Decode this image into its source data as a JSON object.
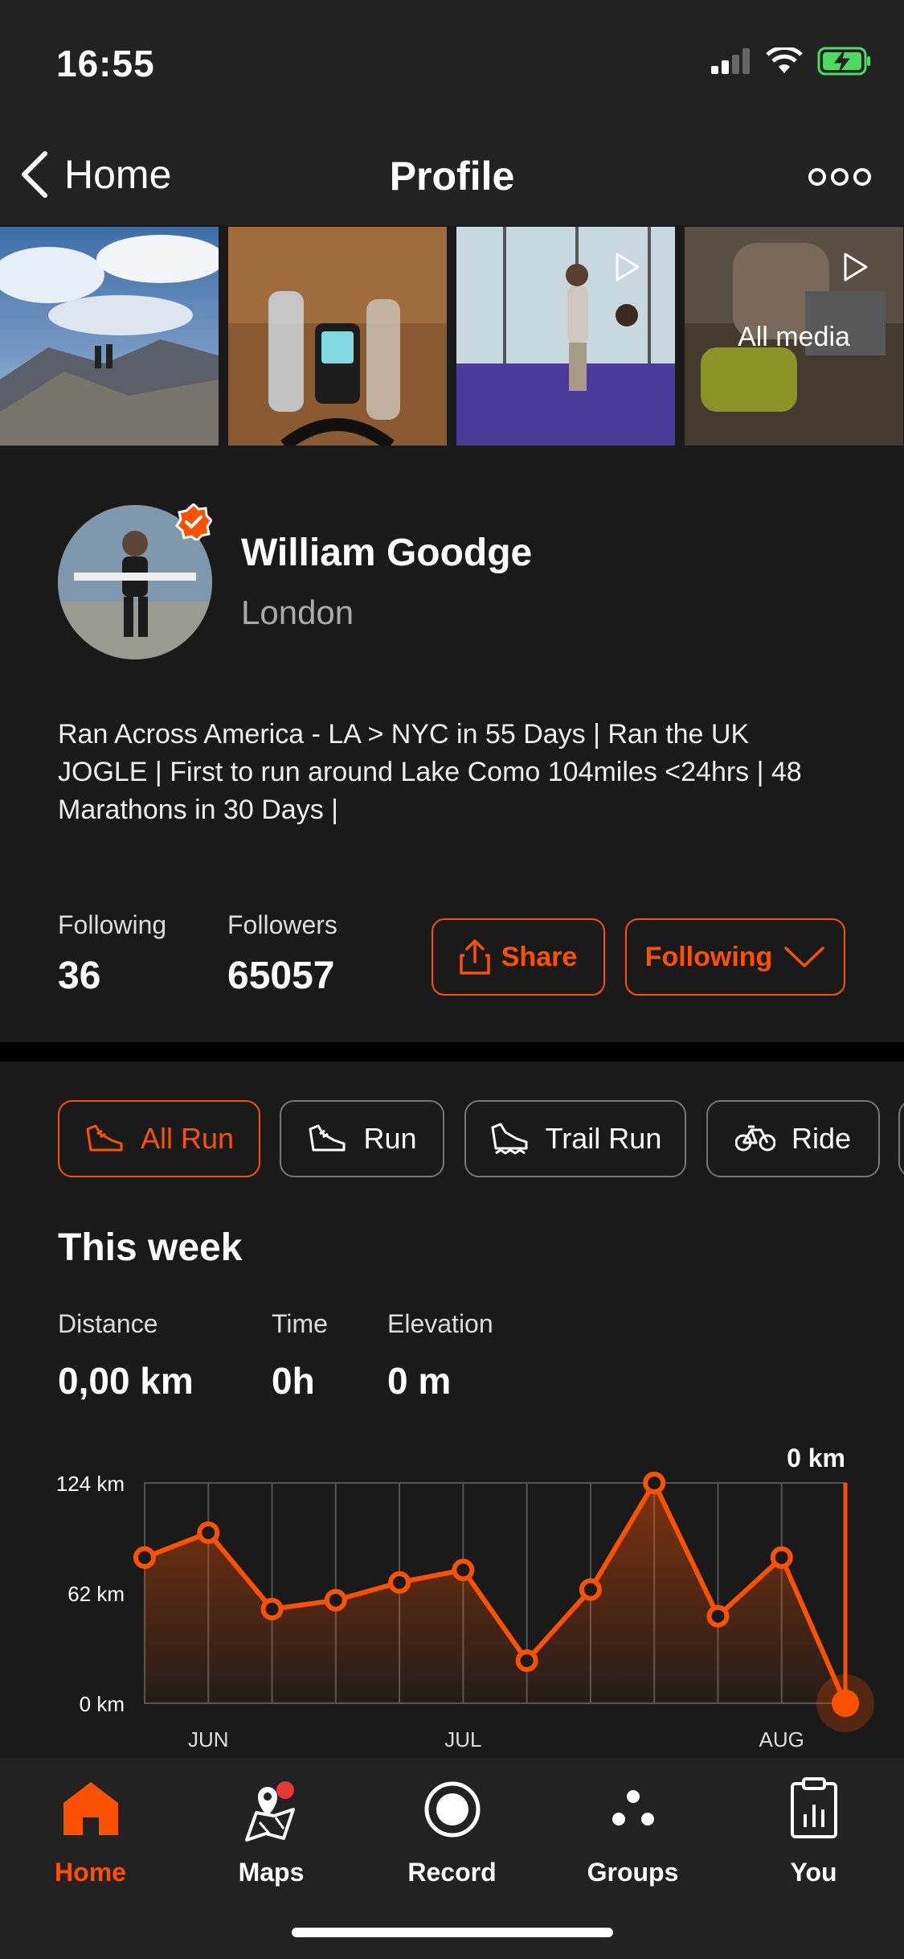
{
  "status_bar": {
    "time": "16:55"
  },
  "nav": {
    "back_label": "Home",
    "title": "Profile"
  },
  "media": {
    "all_media_label": "All media"
  },
  "profile": {
    "name": "William Goodge",
    "location": "London",
    "bio": "Ran Across America - LA > NYC in 55 Days | Ran the UK JOGLE | First to run around Lake Como 104miles <24hrs | 48 Marathons in 30 Days |",
    "following_label": "Following",
    "following_count": "36",
    "followers_label": "Followers",
    "followers_count": "65057",
    "share_label": "Share",
    "following_button_label": "Following"
  },
  "filters": [
    {
      "label": "All Run",
      "icon": "shoe-icon",
      "active": true
    },
    {
      "label": "Run",
      "icon": "shoe-icon",
      "active": false
    },
    {
      "label": "Trail Run",
      "icon": "trail-shoe-icon",
      "active": false
    },
    {
      "label": "Ride",
      "icon": "bike-icon",
      "active": false
    }
  ],
  "week": {
    "title": "This week",
    "distance_label": "Distance",
    "distance_value": "0,00 km",
    "time_label": "Time",
    "time_value": "0h",
    "elevation_label": "Elevation",
    "elevation_value": "0 m"
  },
  "chart_data": {
    "type": "area",
    "current_label": "0 km",
    "y_ticks": [
      "124 km",
      "62 km",
      "0 km"
    ],
    "x_labels": [
      "JUN",
      "JUL",
      "AUG"
    ],
    "ylim": [
      0,
      124
    ],
    "values": [
      82,
      96,
      53,
      58,
      68,
      75,
      24,
      64,
      124,
      49,
      82,
      0
    ],
    "colors": {
      "line": "#fc5200",
      "grid": "#555555"
    }
  },
  "tabs": [
    {
      "label": "Home",
      "icon": "home-icon",
      "active": true
    },
    {
      "label": "Maps",
      "icon": "map-icon",
      "active": false,
      "badge": true
    },
    {
      "label": "Record",
      "icon": "record-icon",
      "active": false
    },
    {
      "label": "Groups",
      "icon": "groups-icon",
      "active": false
    },
    {
      "label": "You",
      "icon": "clipboard-chart-icon",
      "active": false
    }
  ],
  "colors": {
    "accent": "#fc5200",
    "background": "#1a1a1a",
    "bar": "#222222"
  }
}
